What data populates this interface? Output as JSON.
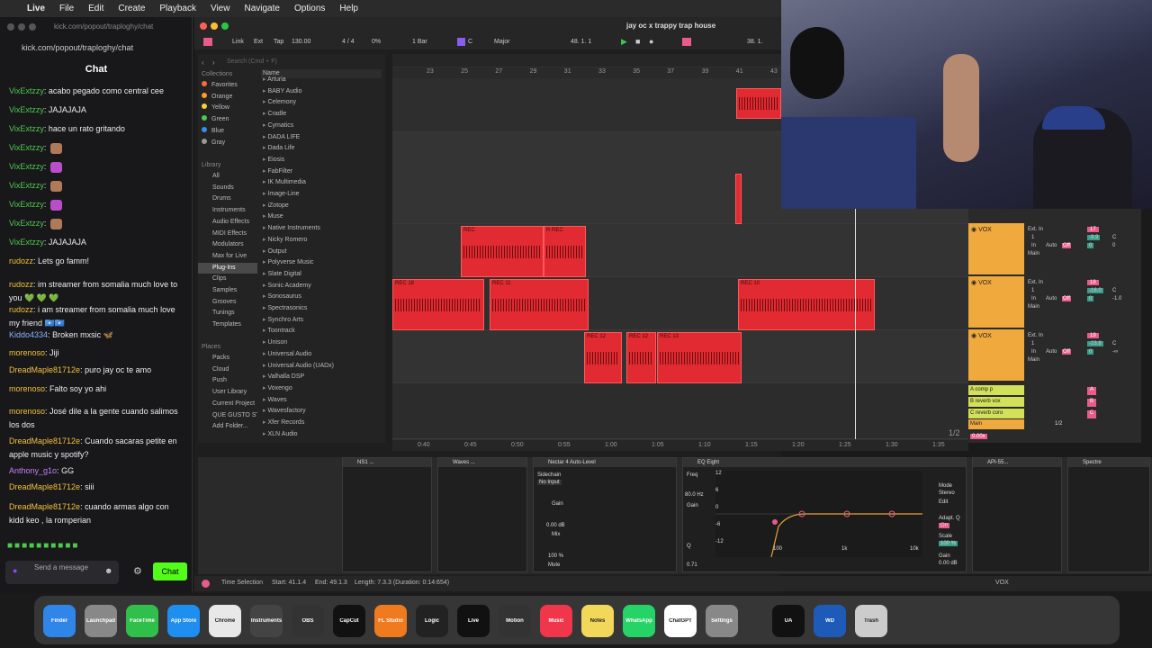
{
  "menubar": {
    "app": "Live",
    "items": [
      "File",
      "Edit",
      "Create",
      "Playback",
      "View",
      "Navigate",
      "Options",
      "Help"
    ]
  },
  "chat": {
    "window_title": "kick.com/popout/traploghy/chat",
    "url": "kick.com/popout/traploghy/chat",
    "title": "Chat",
    "messages": [
      {
        "user": "VixExtzzy",
        "text": "acabo pegado como central cee",
        "color": "#4ec94e"
      },
      {
        "user": "VixExtzzy",
        "text": "JAJAJAJA",
        "color": "#4ec94e"
      },
      {
        "user": "VixExtzzy",
        "text": "hace un rato gritando",
        "color": "#4ec94e"
      },
      {
        "user": "VixExtzzy",
        "text": "",
        "color": "#4ec94e",
        "emote": "#b07a5a"
      },
      {
        "user": "VixExtzzy",
        "text": "",
        "color": "#4ec94e",
        "emote": "#b84ec9"
      },
      {
        "user": "VixExtzzy",
        "text": "",
        "color": "#4ec94e",
        "emote": "#b07a5a"
      },
      {
        "user": "VixExtzzy",
        "text": "",
        "color": "#4ec94e",
        "emote": "#b84ec9"
      },
      {
        "user": "VixExtzzy",
        "text": "",
        "color": "#4ec94e",
        "emote": "#b07a5a"
      },
      {
        "user": "VixExtzzy",
        "text": "JAJAJAJA",
        "color": "#4ec94e"
      },
      {
        "user": "rudozz",
        "text": "Lets go famm!",
        "color": "#f3c13a"
      },
      {
        "user": "rudozz",
        "text": "im streamer from somalia much love to you 💚 💚 💚",
        "color": "#f3c13a"
      },
      {
        "user": "rudozz",
        "text": "i am streamer from somalia much love my friend 🇸🇴🇸🇴",
        "color": "#f3c13a"
      },
      {
        "user": "Kiddo4334",
        "text": "Broken mxsic 🦋",
        "color": "#8ab4f8"
      },
      {
        "user": "morenoso",
        "text": "Jiji",
        "color": "#f3c13a"
      },
      {
        "user": "DreadMaple81712e",
        "text": "puro jay oc te amo",
        "color": "#f3c13a"
      },
      {
        "user": "morenoso",
        "text": "Falto soy yo ahi",
        "color": "#f3c13a"
      },
      {
        "user": "morenoso",
        "text": "José dile a la gente cuando salimos los dos",
        "color": "#f3c13a"
      },
      {
        "user": "DreadMaple81712e",
        "text": "Cuando sacaras petite en apple music y spotify?",
        "color": "#f3c13a"
      },
      {
        "user": "Anthony_g1o",
        "text": "GG",
        "color": "#c77dff"
      },
      {
        "user": "DreadMaple81712e",
        "text": "siii",
        "color": "#f3c13a"
      },
      {
        "user": "DreadMaple81712e",
        "text": "cuando armas algo con kidd keo , la romperian",
        "color": "#f3c13a"
      }
    ],
    "input_placeholder": "Send a message",
    "send_label": "Chat"
  },
  "ableton": {
    "project_title": "jay oc x trappy trap house",
    "transport": {
      "link": "Link",
      "ext": "Ext",
      "tap": "Tap",
      "tempo": "130.00",
      "signature": "4 / 4",
      "cpu": "0%",
      "quantize": "1 Bar",
      "key": "C",
      "scale": "Major",
      "position": "48.  1.  1",
      "loop_end": "38.  1."
    },
    "browser": {
      "search_placeholder": "Search (Cmd + F)",
      "collections_label": "Collections",
      "collections": [
        {
          "name": "Favorites",
          "color": "#ff6a3d"
        },
        {
          "name": "Orange",
          "color": "#ff9a2a"
        },
        {
          "name": "Yellow",
          "color": "#f5d23a"
        },
        {
          "name": "Green",
          "color": "#4ec94e"
        },
        {
          "name": "Blue",
          "color": "#3a8cf0"
        },
        {
          "name": "Gray",
          "color": "#999999"
        }
      ],
      "library_label": "Library",
      "library": [
        "All",
        "Sounds",
        "Drums",
        "Instruments",
        "Audio Effects",
        "MIDI Effects",
        "Modulators",
        "Max for Live",
        "Plug-Ins",
        "Clips",
        "Samples",
        "Grooves",
        "Tunings",
        "Templates"
      ],
      "places_label": "Places",
      "places": [
        "Packs",
        "Cloud",
        "Push",
        "User Library",
        "Current Project",
        "QUE GUSTO ST",
        "Add Folder..."
      ],
      "name_header": "Name",
      "plugins": [
        "Arturia",
        "BABY Audio",
        "Celemony",
        "Cradle",
        "Cymatics",
        "DADA LIFE",
        "Dada Life",
        "Eiosis",
        "FabFilter",
        "IK Multimedia",
        "Image-Line",
        "iZotope",
        "Muse",
        "Native Instruments",
        "Nicky Romero",
        "Output",
        "Polyverse Music",
        "Slate Digital",
        "Sonic Academy",
        "Sonosaurus",
        "Spectrasonics",
        "Synchro Arts",
        "Toontrack",
        "Unison",
        "Universal Audio",
        "Universal Audio (UADx)",
        "Valhalla DSP",
        "Voxengo",
        "Waves",
        "Wavesfactory",
        "Xfer Records",
        "XLN Audio"
      ]
    },
    "bar_ruler": [
      "23",
      "25",
      "27",
      "29",
      "31",
      "33",
      "35",
      "37",
      "39",
      "41",
      "43"
    ],
    "time_ruler": [
      "0:40",
      "0:45",
      "0:50",
      "0:55",
      "1:00",
      "1:05",
      "1:10",
      "1:15",
      "1:20",
      "1:25",
      "1:30",
      "1:35"
    ],
    "clips": [
      {
        "label": "REC",
        "lane": 1
      },
      {
        "label": "R REC",
        "lane": 1
      },
      {
        "label": "REC 18",
        "lane": 2
      },
      {
        "label": "REC 11",
        "lane": 2
      },
      {
        "label": "REC 10",
        "lane": 2
      },
      {
        "label": "REC 12",
        "lane": 3
      },
      {
        "label": "REC 12",
        "lane": 3
      },
      {
        "label": "REC 13",
        "lane": 3
      }
    ],
    "page_indicator": "1/2",
    "mixer": {
      "tracks": [
        {
          "name": "VOX",
          "input": "Ext. In",
          "ch": "1",
          "num": "17",
          "vol": "-9.9",
          "pan": "C",
          "send": "0",
          "send2": "0"
        },
        {
          "name": "VOX",
          "input": "Ext. In",
          "ch": "1",
          "num": "18",
          "vol": "-16.0",
          "pan": "C",
          "send": "0",
          "send2": "-1.0"
        },
        {
          "name": "VOX",
          "input": "Ext. In",
          "ch": "1",
          "num": "19",
          "vol": "-23.8",
          "pan": "C",
          "send": "0",
          "send2": "-∞"
        }
      ],
      "returns": [
        {
          "name": "A comp p",
          "letter": "A"
        },
        {
          "name": "B reverb vox",
          "letter": "B"
        },
        {
          "name": "C reverb coro",
          "letter": "C"
        }
      ],
      "main": {
        "name": "Main",
        "out": "1/2",
        "vol": "0",
        "pan": "C"
      },
      "monitor_labels": {
        "in": "In",
        "auto": "Auto",
        "off": "Off",
        "main": "Main"
      },
      "zoom": "0.00x"
    },
    "devices": [
      {
        "name": "NS1 ..."
      },
      {
        "name": "Waves ..."
      },
      {
        "name": "Nectar 4 Auto-Level"
      },
      {
        "name": "EQ Eight"
      },
      {
        "name": "API-55..."
      },
      {
        "name": "Spectre"
      }
    ],
    "device_params": {
      "sidechain": "Sidechain",
      "no_input": "No Input",
      "gain": "Gain",
      "gain_val": "0.00 dB",
      "mix": "Mix",
      "mix_val": "100 %",
      "mute": "Mute",
      "freq": "Freq",
      "freq_val": "80.0 Hz",
      "q": "Q",
      "q_val": "0.71",
      "eq_gain_val": "0.00 dB",
      "mode": "Mode",
      "stereo": "Stereo",
      "edit": "Edit",
      "adapt_q": "Adapt. Q",
      "on": "On",
      "scale": "Scale",
      "scale_val": "100 %",
      "none": "none"
    },
    "eq_axis": {
      "db": [
        "12",
        "6",
        "0",
        "-6",
        "-12"
      ],
      "hz": [
        "100",
        "1k",
        "10k"
      ]
    },
    "status": {
      "selection": "Time Selection",
      "start": "Start: 41.1.4",
      "end": "End: 49.1.3",
      "length": "Length: 7.3.3 (Duration: 0:14:654)",
      "track": "VOX"
    }
  },
  "dock": {
    "apps": [
      "Finder",
      "Launchpad",
      "FaceTime",
      "App Store",
      "Chrome",
      "Instruments",
      "OBS",
      "CapCut",
      "FL Studio",
      "Logic",
      "Live",
      "Motion",
      "Music",
      "Notes",
      "WhatsApp",
      "ChatGPT",
      "Settings",
      "UA",
      "WD",
      "Trash"
    ]
  }
}
